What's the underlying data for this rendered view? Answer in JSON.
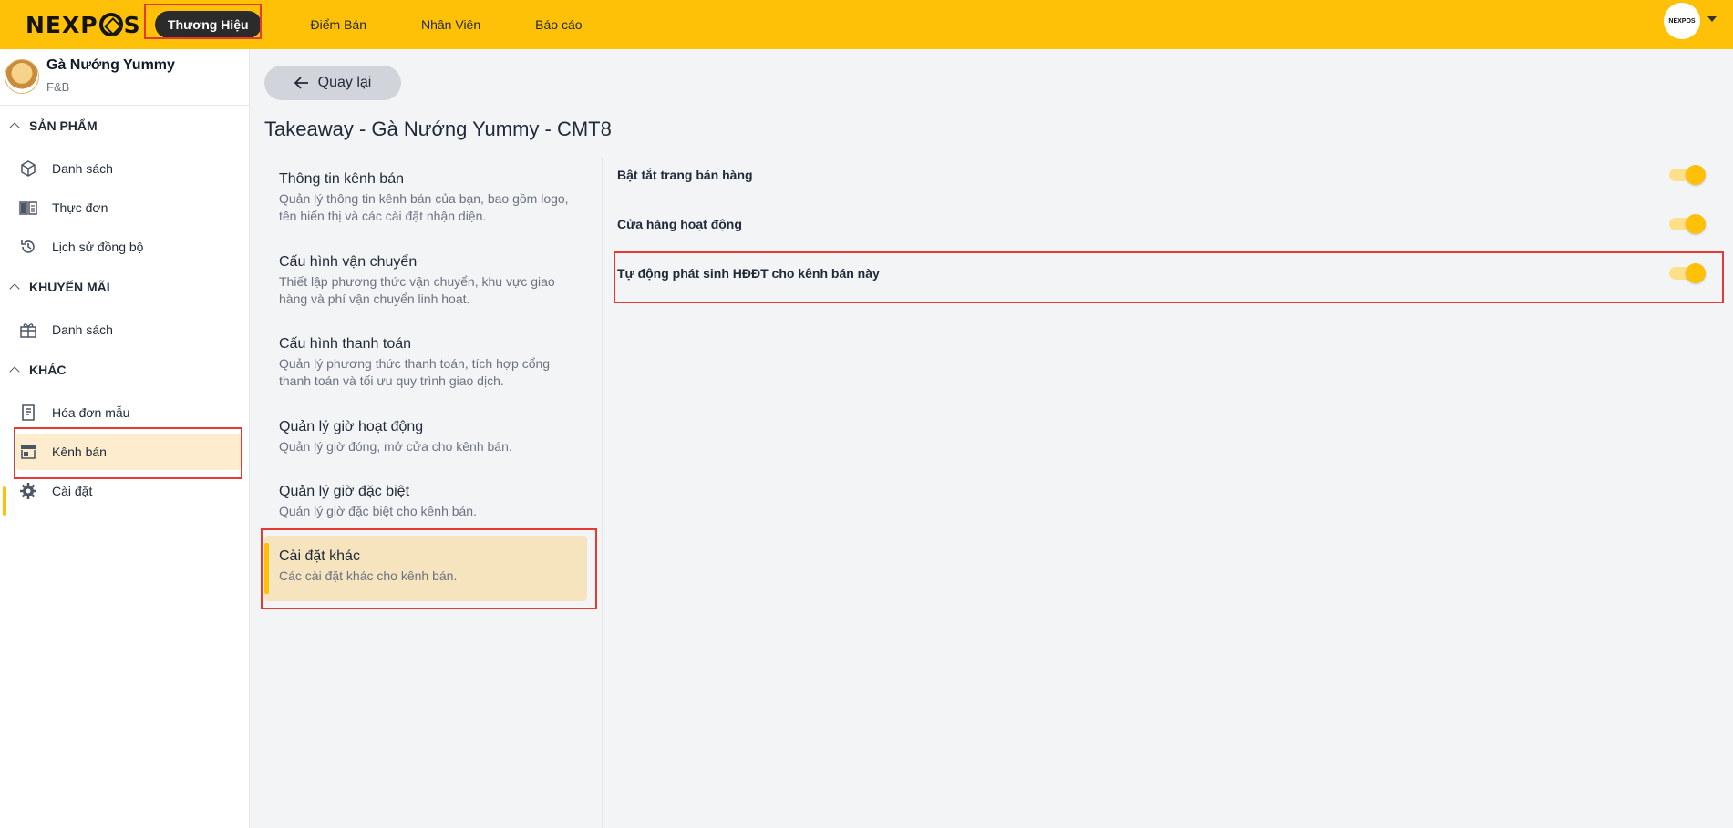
{
  "header": {
    "logo_text_left": "NEXP",
    "logo_text_right": "S",
    "nav": [
      {
        "label": "Thương Hiệu"
      },
      {
        "label": "Điểm Bán"
      },
      {
        "label": "Nhân Viên"
      },
      {
        "label": "Báo cáo"
      }
    ],
    "avatar_text": "NEXPOS"
  },
  "sidebar": {
    "brand_name": "Gà Nướng Yummy",
    "brand_type": "F&B",
    "sections": [
      {
        "title": "SẢN PHẨM",
        "items": [
          {
            "label": "Danh sách",
            "icon": "cube-icon"
          },
          {
            "label": "Thực đơn",
            "icon": "book-icon"
          },
          {
            "label": "Lịch sử đồng bộ",
            "icon": "history-icon"
          }
        ]
      },
      {
        "title": "KHUYẾN MÃI",
        "items": [
          {
            "label": "Danh sách",
            "icon": "gift-icon"
          }
        ]
      },
      {
        "title": "KHÁC",
        "items": [
          {
            "label": "Hóa đơn mẫu",
            "icon": "receipt-icon"
          },
          {
            "label": "Kênh bán",
            "icon": "store-icon"
          },
          {
            "label": "Cài đặt",
            "icon": "gear-icon"
          }
        ]
      }
    ]
  },
  "main": {
    "back_label": "Quay lại",
    "title": "Takeaway - Gà Nướng Yummy - CMT8",
    "menu": [
      {
        "title": "Thông tin kênh bán",
        "desc": "Quản lý thông tin kênh bán của bạn, bao gồm logo, tên hiển thị và các cài đặt nhận diện."
      },
      {
        "title": "Cấu hình vận chuyển",
        "desc": "Thiết lập phương thức vận chuyển, khu vực giao hàng và phí vận chuyển linh hoạt."
      },
      {
        "title": "Cấu hình thanh toán",
        "desc": "Quản lý phương thức thanh toán, tích hợp cổng thanh toán và tối ưu quy trình giao dịch."
      },
      {
        "title": "Quản lý giờ hoạt động",
        "desc": "Quản lý giờ đóng, mở cửa cho kênh bán."
      },
      {
        "title": "Quản lý giờ đặc biệt",
        "desc": "Quản lý giờ đặc biệt cho kênh bán."
      },
      {
        "title": "Cài đặt khác",
        "desc": "Các cài đặt khác cho kênh bán."
      }
    ],
    "settings": [
      {
        "label": "Bật tắt trang bán hàng",
        "on": true
      },
      {
        "label": "Cửa hàng hoạt động",
        "on": true
      },
      {
        "label": "Tự động phát sinh HĐĐT cho kênh bán này",
        "on": true
      }
    ]
  },
  "colors": {
    "accent": "#ffc107",
    "highlight": "#e53935",
    "active_bg": "#fdeccd"
  }
}
